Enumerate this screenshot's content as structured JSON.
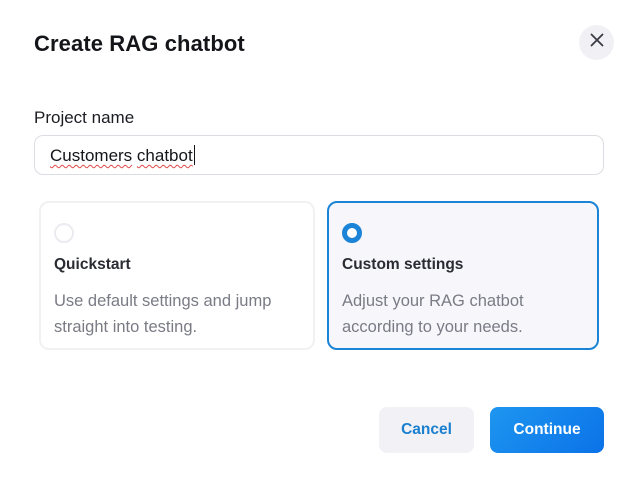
{
  "dialog": {
    "title": "Create RAG chatbot",
    "close_icon": "close-icon"
  },
  "project": {
    "label": "Project name",
    "value": "Customers chatbot",
    "value_words": [
      "Customers",
      "chatbot"
    ]
  },
  "options": [
    {
      "id": "quickstart",
      "title": "Quickstart",
      "description": "Use default settings and jump straight into testing.",
      "selected": false
    },
    {
      "id": "custom",
      "title": "Custom settings",
      "description": "Adjust your RAG chatbot according to your needs.",
      "selected": true
    }
  ],
  "actions": {
    "cancel_label": "Cancel",
    "continue_label": "Continue"
  },
  "colors": {
    "accent": "#1b84d6",
    "continue_bg": "#0b72e8",
    "cancel_bg": "#f1f1f6",
    "spellcheck": "#e04848"
  }
}
